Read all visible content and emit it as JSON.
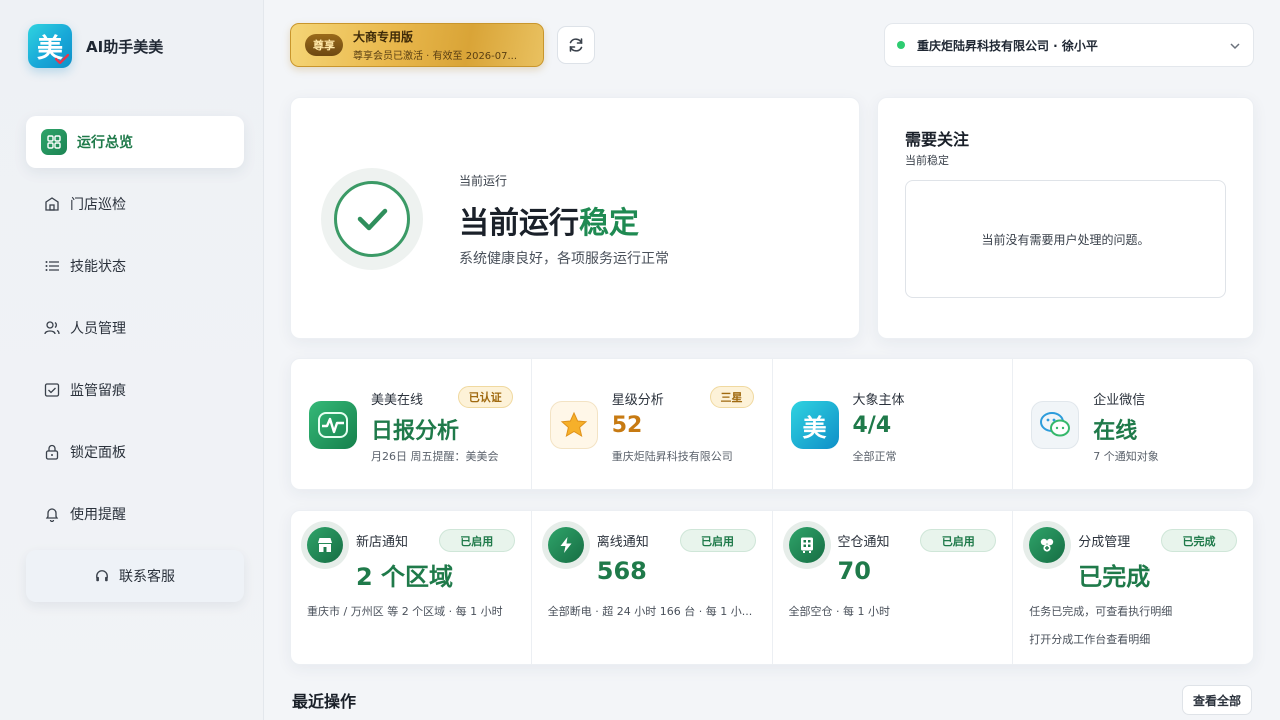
{
  "app": {
    "title": "AI助手美美",
    "logo_char": "美"
  },
  "sidebar": {
    "items": [
      {
        "label": "运行总览",
        "icon": "grid-icon",
        "active": true
      },
      {
        "label": "门店巡检",
        "icon": "store-icon"
      },
      {
        "label": "技能状态",
        "icon": "list-icon"
      },
      {
        "label": "人员管理",
        "icon": "users-icon"
      },
      {
        "label": "监管留痕",
        "icon": "monitor-check-icon"
      },
      {
        "label": "锁定面板",
        "icon": "lock-icon"
      },
      {
        "label": "使用提醒",
        "icon": "bell-icon"
      }
    ],
    "contact_label": "联系客服"
  },
  "header": {
    "vip_badge": "尊享",
    "vip_title": "大商专用版",
    "vip_sub": "尊享会员已激活 · 有效至 2026-07...",
    "company": "重庆炬陆昇科技有限公司 · 徐小平"
  },
  "status": {
    "small": "当前运行",
    "big_prefix": "当前运行",
    "big_highlight": "稳定",
    "desc": "系统健康良好，各项服务运行正常"
  },
  "attention": {
    "title": "需要关注",
    "sub": "当前稳定",
    "message": "当前没有需要用户处理的问题。"
  },
  "metrics": [
    {
      "label": "美美在线",
      "value": "日报分析",
      "sub": "月26日 周五提醒：美美会",
      "tag": "已认证",
      "value_color": "#1f7a4a"
    },
    {
      "label": "星级分析",
      "value": "52",
      "sub": "重庆炬陆昇科技有限公司",
      "tag": "三星",
      "value_color": "#c77a12"
    },
    {
      "label": "大象主体",
      "value": "4/4",
      "sub": "全部正常",
      "value_color": "#1f7a4a",
      "icon_char": "美"
    },
    {
      "label": "企业微信",
      "value": "在线",
      "sub": "7 个通知对象",
      "value_color": "#1f7a4a"
    }
  ],
  "notices": [
    {
      "label": "新店通知",
      "value": "2 个区域",
      "tag": "已启用",
      "sub": "重庆市 / 万州区 等 2 个区域 · 每 1 小时"
    },
    {
      "label": "离线通知",
      "value": "568",
      "tag": "已启用",
      "sub": "全部断电 · 超 24 小时 166 台 · 每 1 小..."
    },
    {
      "label": "空仓通知",
      "value": "70",
      "tag": "已启用",
      "sub": "全部空仓 · 每 1 小时"
    },
    {
      "label": "分成管理",
      "value": "已完成",
      "tag": "已完成",
      "sub": "任务已完成，可查看执行明细",
      "sub2": "打开分成工作台查看明细"
    }
  ],
  "recent": {
    "title": "最近操作",
    "view_all": "查看全部"
  }
}
